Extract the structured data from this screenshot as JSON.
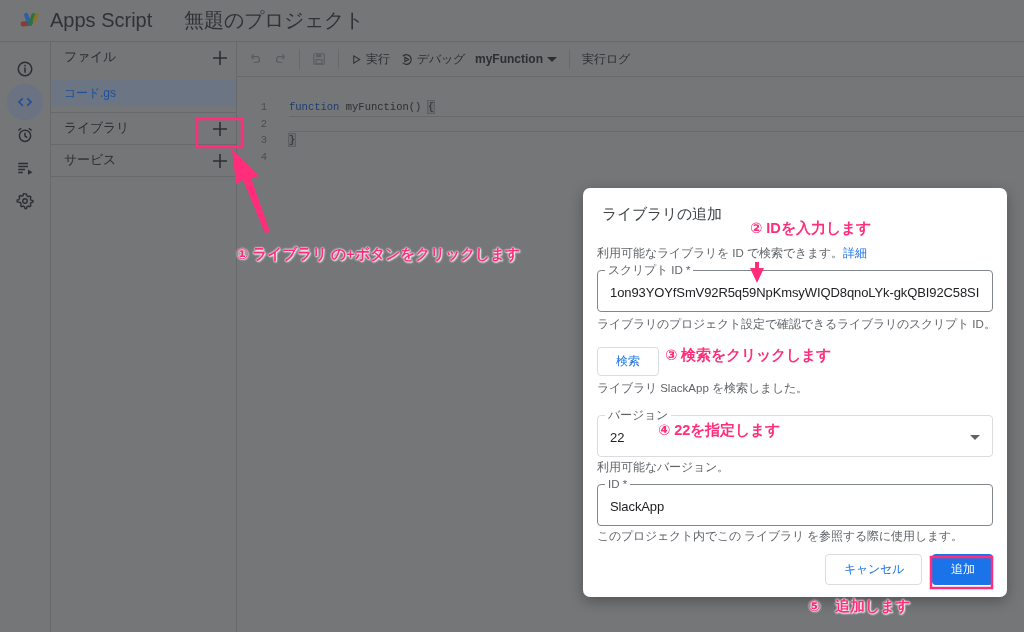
{
  "header": {
    "product": "Apps Script",
    "project_title": "無題のプロジェクト"
  },
  "rail": [
    {
      "kind": "info",
      "selected": false
    },
    {
      "kind": "code",
      "selected": true
    },
    {
      "kind": "clock",
      "selected": false
    },
    {
      "kind": "runs",
      "selected": false
    },
    {
      "kind": "gear",
      "selected": false
    }
  ],
  "file_panel": {
    "sections": [
      {
        "label": "ファイル",
        "files": [
          {
            "name": "コード.gs",
            "selected": true
          }
        ]
      },
      {
        "label": "ライブラリ"
      },
      {
        "label": "サービス"
      }
    ]
  },
  "toolbar": {
    "run": "実行",
    "debug": "デバッグ",
    "function": "myFunction",
    "log": "実行ログ"
  },
  "editor": {
    "lines": [
      {
        "number": "1",
        "tokens": [
          {
            "kind": "keyword",
            "text": "function"
          },
          {
            "kind": "plain",
            "text": " myFunction() "
          },
          {
            "kind": "brace",
            "text": "{"
          }
        ]
      },
      {
        "number": "2"
      },
      {
        "number": "3",
        "tokens": [
          {
            "kind": "brace",
            "text": "}"
          }
        ]
      },
      {
        "number": "4"
      }
    ]
  },
  "dialog": {
    "title": "ライブラリの追加",
    "description": "利用可能なライブラリを ID で検索できます。",
    "details_link": "詳細",
    "fields": [
      {
        "kind": "text",
        "label": "スクリプト ID *",
        "value": "1on93YOYfSmV92R5q59NpKmsyWIQD8qnoLYk-gkQBI92C58SI",
        "hint": "ライブラリのプロジェクト設定で確認できるライブラリのスクリプト ID。"
      },
      {
        "kind": "search",
        "button": "検索",
        "hint": "ライブラリ SlackApp を検索しました。"
      },
      {
        "kind": "select",
        "label": "バージョン",
        "value": "22",
        "hint": "利用可能なバージョン。"
      },
      {
        "kind": "text",
        "label": "ID *",
        "value": "SlackApp",
        "hint": "このプロジェクト内でこの ライブラリ を参照する際に使用します。"
      }
    ],
    "buttons": [
      {
        "label": "キャンセル",
        "kind": "secondary"
      },
      {
        "label": "追加",
        "kind": "primary"
      }
    ]
  },
  "annotations": [
    {
      "text": "① ライブラリ の+ボタンをクリックします"
    },
    {
      "text": "② IDを入力します"
    },
    {
      "text": "③ 検索をクリックします"
    },
    {
      "text": "④ 22を指定します"
    },
    {
      "text": "⑤　追加します"
    }
  ]
}
